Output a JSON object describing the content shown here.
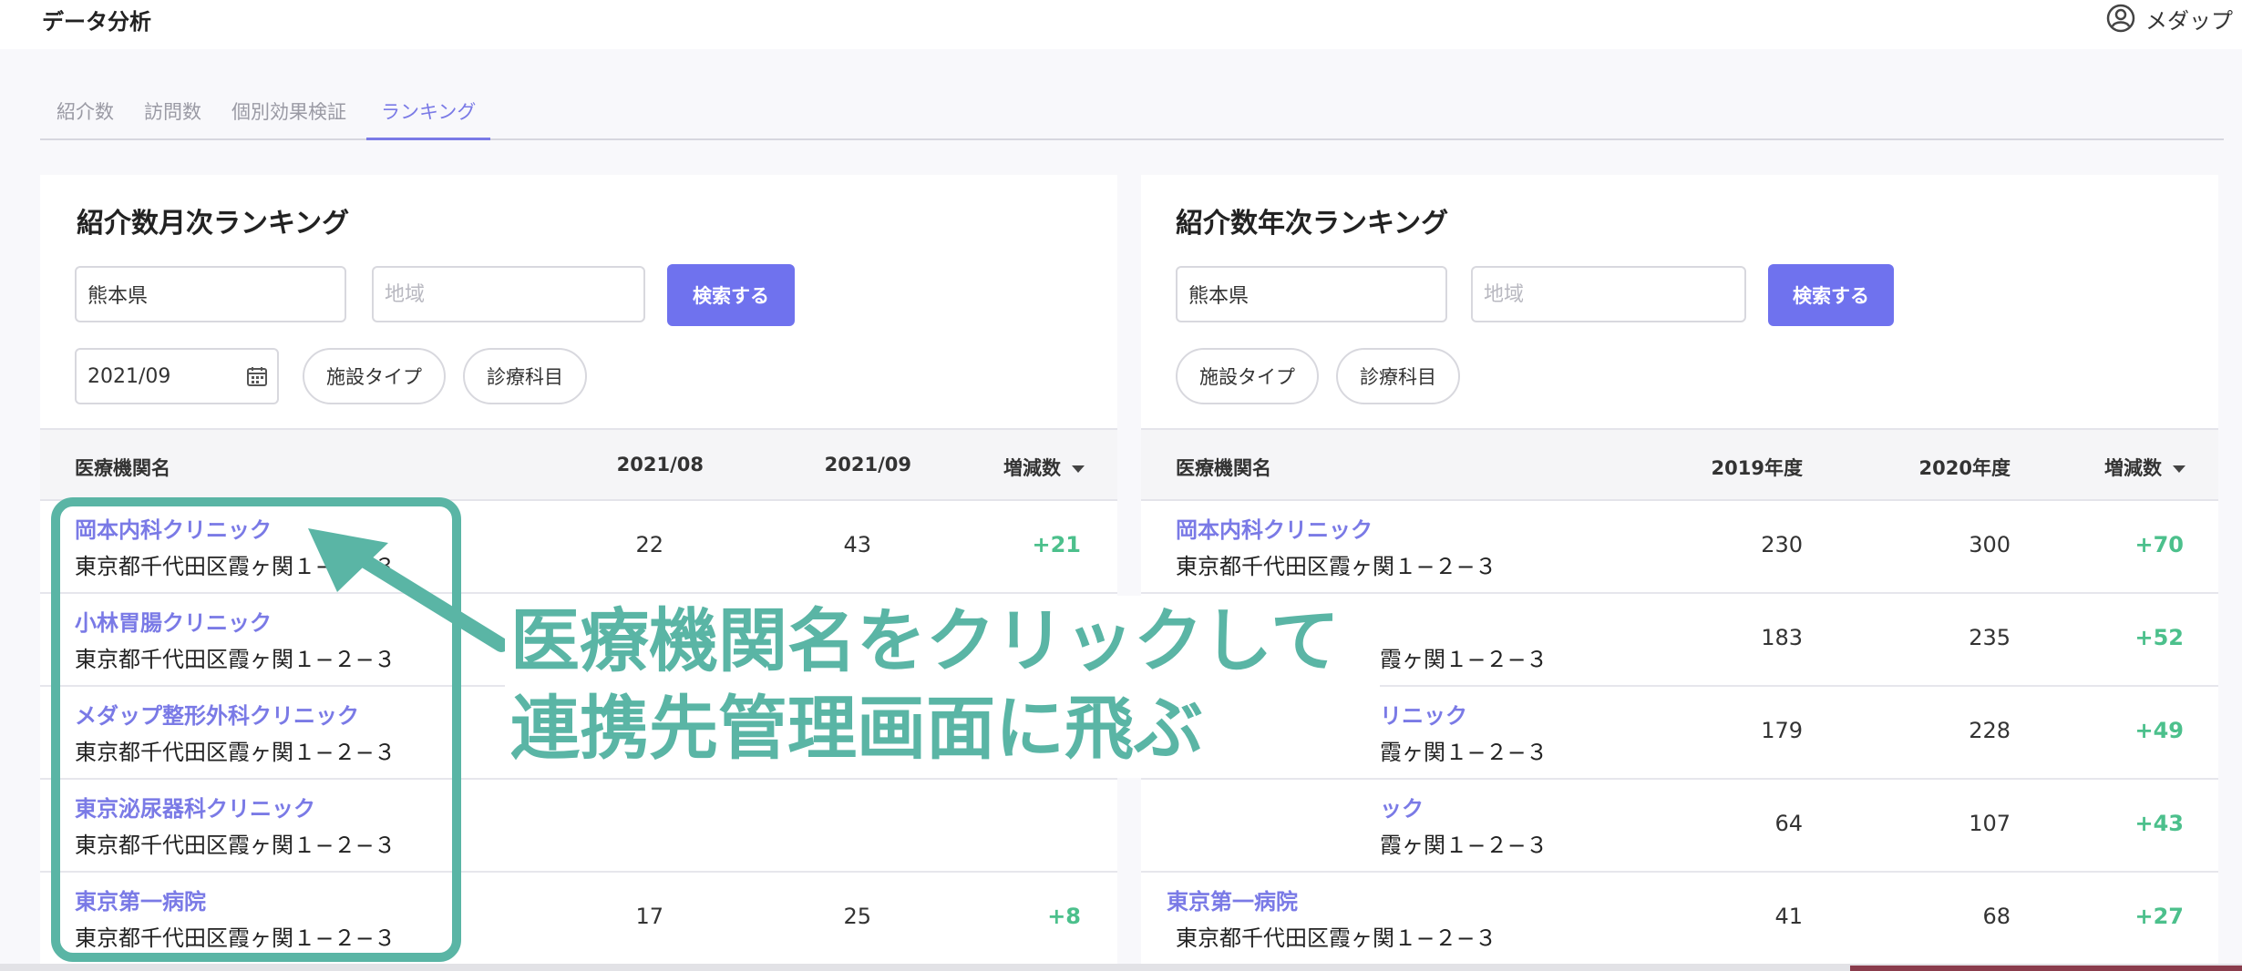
{
  "header": {
    "title": "データ分析",
    "user_name": "メダップ"
  },
  "tabs": [
    {
      "label": "紹介数"
    },
    {
      "label": "訪問数"
    },
    {
      "label": "個別効果検証"
    },
    {
      "label": "ランキング"
    }
  ],
  "monthly": {
    "title": "紹介数月次ランキング",
    "prefecture_value": "熊本県",
    "region_placeholder": "地域",
    "search_label": "検索する",
    "date_value": "2021/09",
    "facility_type_label": "施設タイプ",
    "department_label": "診療科目",
    "columns": {
      "name": "医療機関名",
      "prev": "2021/08",
      "curr": "2021/09",
      "diff": "増減数"
    },
    "rows": [
      {
        "name": "岡本内科クリニック",
        "address": "東京都千代田区霞ヶ関１−２−３",
        "prev": "22",
        "curr": "43",
        "diff": "+21"
      },
      {
        "name": "小林胃腸クリニック",
        "address": "東京都千代田区霞ヶ関１−２−３",
        "prev": "",
        "curr": "",
        "diff": ""
      },
      {
        "name": "メダップ整形外科クリニック",
        "address": "東京都千代田区霞ヶ関１−２−３",
        "prev": "",
        "curr": "",
        "diff": ""
      },
      {
        "name": "東京泌尿器科クリニック",
        "address": "東京都千代田区霞ヶ関１−２−３",
        "prev": "",
        "curr": "",
        "diff": ""
      },
      {
        "name": "東京第一病院",
        "address": "東京都千代田区霞ヶ関１−２−３",
        "prev": "17",
        "curr": "25",
        "diff": "+8"
      }
    ]
  },
  "yearly": {
    "title": "紹介数年次ランキング",
    "prefecture_value": "熊本県",
    "region_placeholder": "地域",
    "search_label": "検索する",
    "facility_type_label": "施設タイプ",
    "department_label": "診療科目",
    "columns": {
      "name": "医療機関名",
      "prev": "2019年度",
      "curr": "2020年度",
      "diff": "増減数"
    },
    "rows": [
      {
        "name": "岡本内科クリニック",
        "address": "東京都千代田区霞ヶ関１−２−３",
        "prev": "230",
        "curr": "300",
        "diff": "+70"
      },
      {
        "name": "",
        "address": "霞ヶ関１−２−３",
        "prev": "183",
        "curr": "235",
        "diff": "+52"
      },
      {
        "name": "リニック",
        "address": "霞ヶ関１−２−３",
        "prev": "179",
        "curr": "228",
        "diff": "+49"
      },
      {
        "name": "ック",
        "address": "霞ヶ関１−２−３",
        "prev": "64",
        "curr": "107",
        "diff": "+43"
      },
      {
        "name": "東京第一病院",
        "address": "東京都千代田区霞ヶ関１−２−３",
        "prev": "41",
        "curr": "68",
        "diff": "+27"
      }
    ]
  },
  "annotation": {
    "line1": "医療機関名をクリックして",
    "line2": "連携先管理画面に飛ぶ",
    "color": "#5ab5a5"
  },
  "colors": {
    "accent": "#6f72ee",
    "link": "#7a7ae6",
    "positive": "#4cc08c"
  }
}
